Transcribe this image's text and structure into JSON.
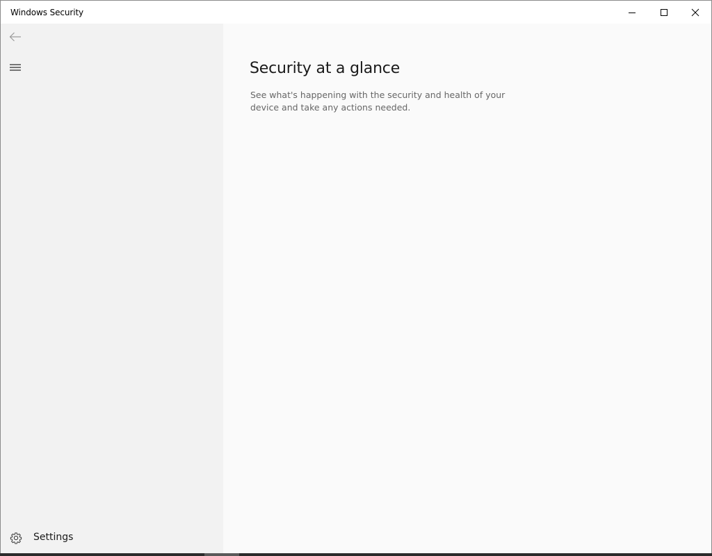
{
  "window": {
    "title": "Windows Security"
  },
  "sidebar": {
    "back_icon": "back-arrow-icon",
    "menu_icon": "hamburger-menu-icon",
    "settings": {
      "icon": "gear-icon",
      "label": "Settings"
    }
  },
  "main": {
    "title": "Security at a glance",
    "description": "See what's happening with the security and health of your device and take any actions needed."
  },
  "colors": {
    "sidebar_bg": "#f2f2f2",
    "main_bg": "#fafafa",
    "titlebar_bg": "#ffffff",
    "description_text": "#666666"
  }
}
